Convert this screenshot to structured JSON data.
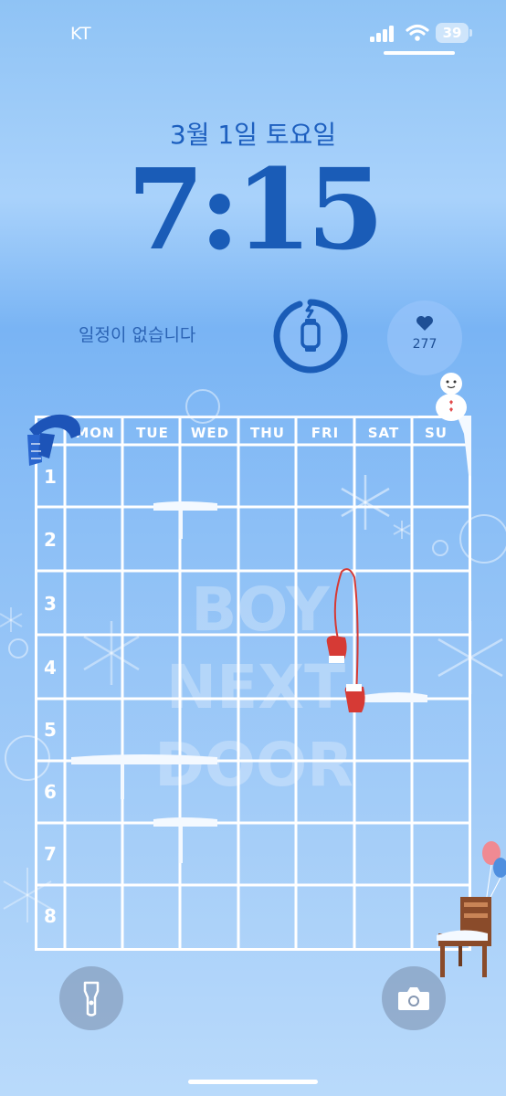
{
  "status_bar": {
    "carrier": "KT",
    "battery_level": "39"
  },
  "lock_screen": {
    "date": "3월 1일 토요일",
    "time": "7:15"
  },
  "widgets": {
    "calendar_text": "일정이 없습니다",
    "watch_icon": "watch-charging-icon",
    "heart_count": "277",
    "heart_icon": "heart-icon"
  },
  "wallpaper": {
    "days": [
      "MON",
      "TUE",
      "WED",
      "THU",
      "FRI",
      "SAT",
      "SUN"
    ],
    "periods": [
      "1",
      "2",
      "3",
      "4",
      "5",
      "6",
      "7",
      "8"
    ],
    "watermark": [
      "BOY",
      "NEXT",
      "DOOR"
    ]
  },
  "bottom_controls": {
    "flashlight": "flashlight-icon",
    "camera": "camera-icon"
  },
  "colors": {
    "accent": "#1a5cb7",
    "heart": "#1e4f95",
    "mitten": "#d63a35",
    "scarf": "#1d54b8"
  }
}
